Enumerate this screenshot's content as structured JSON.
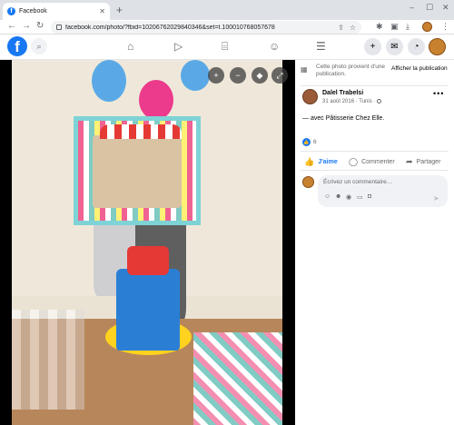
{
  "browser": {
    "tab_title": "Facebook",
    "tab_favicon": "f",
    "url": "facebook.com/photo/?fbid=10206762029840346&set=t.100010768057678"
  },
  "fb_header": {
    "logo": "f",
    "nav_icons": [
      "home-icon",
      "video-icon",
      "marketplace-icon",
      "groups-icon",
      "menu-icon"
    ],
    "right_icons": [
      "create-icon",
      "messenger-icon",
      "notifications-icon"
    ]
  },
  "viewer": {
    "controls": [
      "zoom-in-icon",
      "zoom-out-icon",
      "tag-icon",
      "fullscreen-icon"
    ]
  },
  "panel": {
    "notice_text": "Cette photo provient d'une publication.",
    "notice_link": "Afficher la publication",
    "author_name": "Dalel Trabelsi",
    "post_date": "31 août 2016 · Tunis ·",
    "caption_prefix": "— avec ",
    "caption_name": "Pâtisserie Chez Elle",
    "caption_suffix": ".",
    "reaction_count": "6",
    "actions": {
      "like": "J'aime",
      "comment": "Commenter",
      "share": "Partager"
    },
    "comment_placeholder": "Écrivez un commentaire…"
  },
  "colors": {
    "facebook_blue": "#1877f2",
    "secondary_text": "#65676b",
    "comment_bg": "#f0f2f5"
  }
}
